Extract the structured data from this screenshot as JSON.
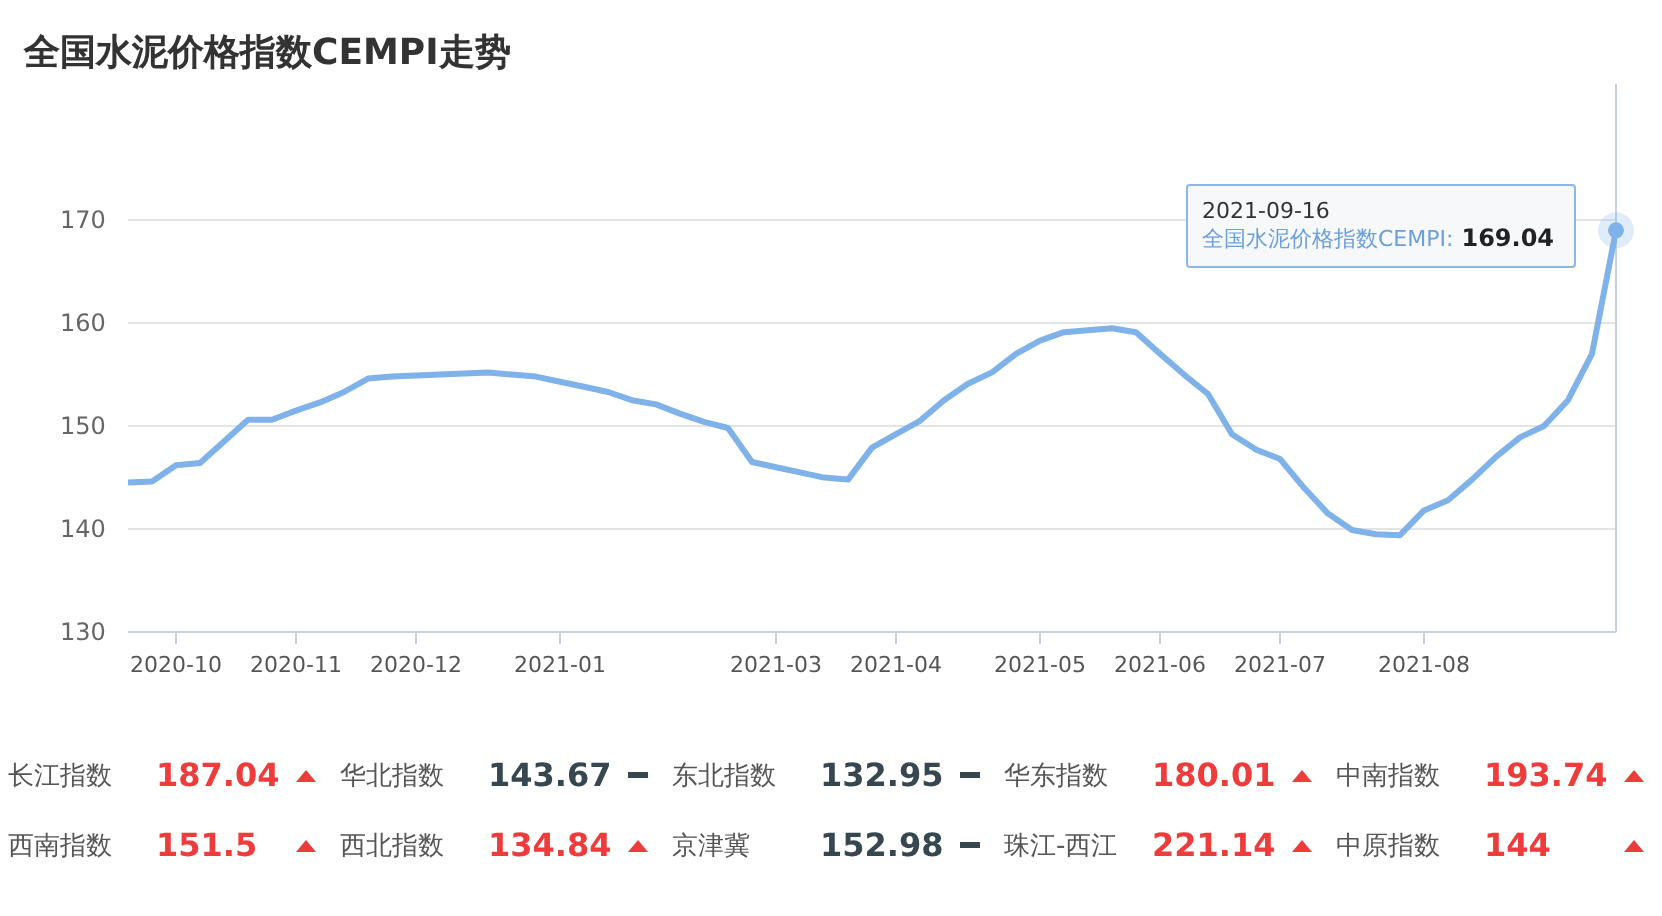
{
  "title": "全国水泥价格指数CEMPI走势",
  "chart": {
    "chart_data": {
      "type": "line",
      "grid": true,
      "ylim": [
        130,
        170
      ],
      "yticks": [
        130,
        140,
        150,
        160,
        170
      ],
      "categories": [
        null,
        null,
        "2020-10",
        null,
        null,
        null,
        null,
        "2020-11",
        null,
        null,
        null,
        null,
        "2020-12",
        null,
        null,
        null,
        null,
        null,
        "2021-01",
        null,
        null,
        null,
        null,
        null,
        null,
        null,
        null,
        "2021-03",
        null,
        null,
        null,
        null,
        "2021-04",
        null,
        null,
        null,
        null,
        null,
        "2021-05",
        null,
        null,
        null,
        null,
        "2021-06",
        null,
        null,
        null,
        null,
        "2021-07",
        null,
        null,
        null,
        null,
        null,
        "2021-08",
        null,
        null,
        null,
        null,
        null,
        null,
        null,
        null
      ],
      "series": [
        {
          "name": "全国水泥价格指数CEMPI",
          "color": "#7eb2e8",
          "values": [
            144.5,
            144.6,
            146.2,
            146.4,
            148.5,
            150.6,
            150.6,
            151.5,
            152.3,
            153.3,
            154.6,
            154.8,
            154.9,
            155.0,
            155.1,
            155.2,
            155.0,
            154.8,
            154.3,
            153.8,
            153.3,
            152.5,
            152.1,
            151.2,
            150.4,
            149.8,
            146.5,
            146.0,
            145.5,
            145.0,
            144.8,
            147.9,
            149.2,
            150.5,
            152.5,
            154.1,
            155.2,
            157.0,
            158.3,
            159.1,
            159.3,
            159.5,
            159.1,
            157.0,
            155.0,
            153.1,
            149.2,
            147.7,
            146.8,
            144.0,
            141.5,
            139.9,
            139.5,
            139.4,
            141.8,
            142.8,
            144.8,
            147.0,
            148.9,
            150.0,
            152.5,
            157.0,
            169.0
          ]
        }
      ]
    },
    "tooltip": {
      "date": "2021-09-16",
      "separator": ":",
      "value": "169.04"
    }
  },
  "indices": [
    {
      "name": "长江指数",
      "value": "187.04",
      "kind": "up"
    },
    {
      "name": "华北指数",
      "value": "143.67",
      "kind": "flat"
    },
    {
      "name": "东北指数",
      "value": "132.95",
      "kind": "flat"
    },
    {
      "name": "华东指数",
      "value": "180.01",
      "kind": "up"
    },
    {
      "name": "中南指数",
      "value": "193.74",
      "kind": "up"
    },
    {
      "name": "西南指数",
      "value": "151.5",
      "kind": "up"
    },
    {
      "name": "西北指数",
      "value": "134.84",
      "kind": "up"
    },
    {
      "name": "京津冀",
      "value": "152.98",
      "kind": "flat"
    },
    {
      "name": "珠江-西江",
      "value": "221.14",
      "kind": "up"
    },
    {
      "name": "中原指数",
      "value": "144",
      "kind": "up"
    }
  ]
}
